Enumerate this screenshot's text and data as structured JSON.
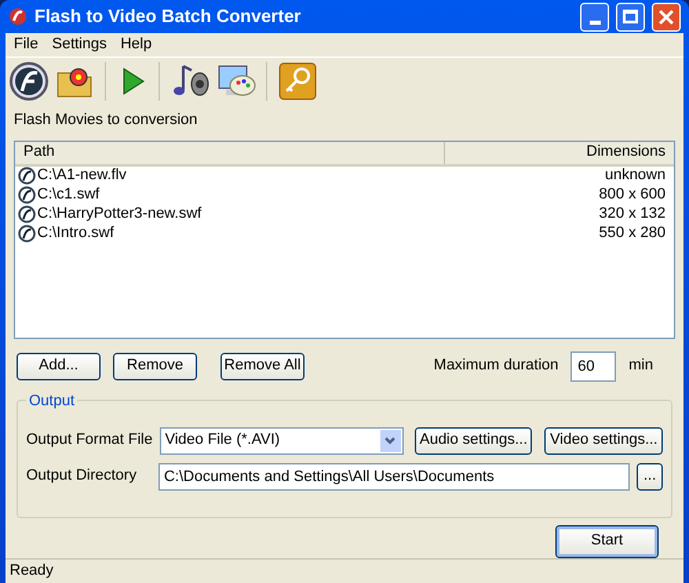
{
  "window": {
    "title": "Flash to Video Batch Converter"
  },
  "menu": [
    "File",
    "Settings",
    "Help"
  ],
  "list_label": "Flash Movies to conversion",
  "table": {
    "columns": [
      "Path",
      "Dimensions"
    ],
    "rows": [
      {
        "path": "C:\\A1-new.flv",
        "dimensions": "unknown"
      },
      {
        "path": "C:\\c1.swf",
        "dimensions": "800 x 600"
      },
      {
        "path": "C:\\HarryPotter3-new.swf",
        "dimensions": "320 x 132"
      },
      {
        "path": "C:\\Intro.swf",
        "dimensions": "550 x 280"
      }
    ]
  },
  "list_buttons": [
    "Add...",
    "Remove",
    "Remove All"
  ],
  "max_duration": {
    "label": "Maximum duration",
    "value": "60",
    "unit": "min"
  },
  "output": {
    "title": "Output",
    "format_label": "Output Format File",
    "format_value": "Video File (*.AVI)",
    "audio_button": "Audio settings...",
    "video_button": "Video settings...",
    "directory_label": "Output Directory",
    "directory_value": "C:\\Documents and Settings\\All Users\\Documents",
    "browse_button": "..."
  },
  "start_button": "Start",
  "status_bar": "Ready"
}
